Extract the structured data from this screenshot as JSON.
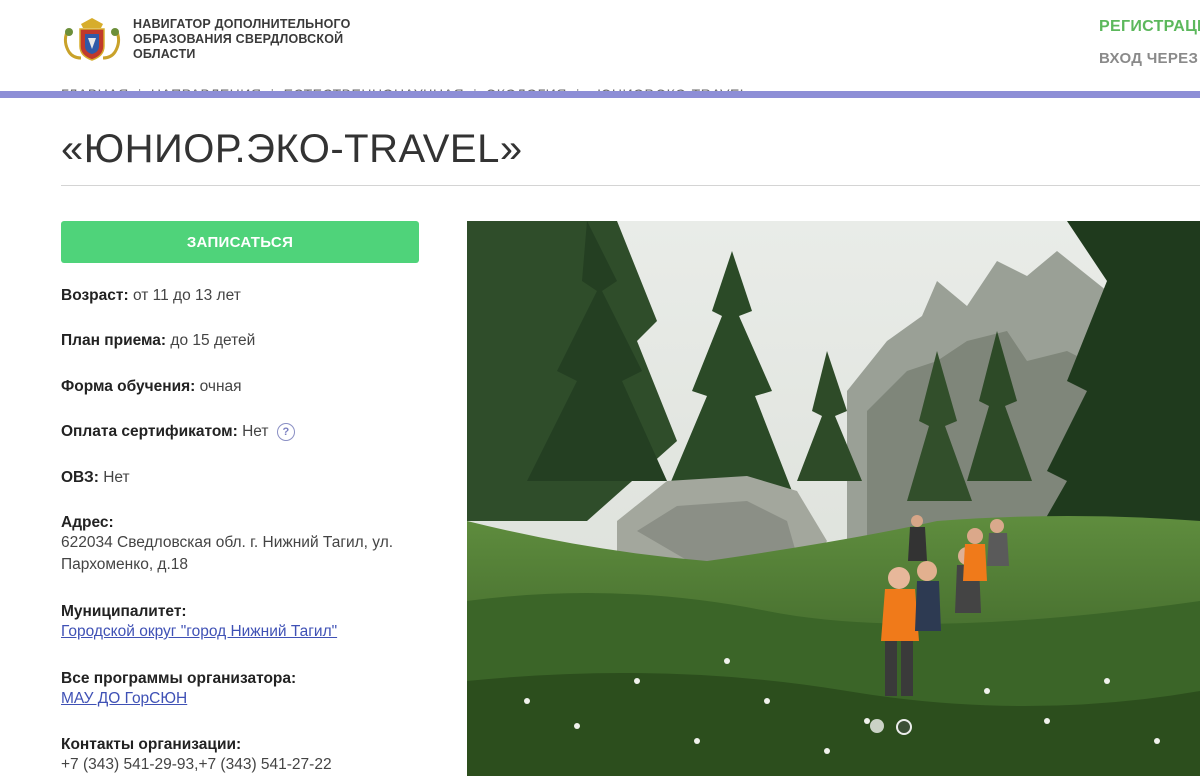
{
  "header": {
    "site_name": "НАВИГАТОР ДОПОЛНИТЕЛЬНОГО ОБРАЗОВАНИЯ СВЕРДЛОВСКОЙ ОБЛАСТИ",
    "register_label": "РЕГИСТРАЦИЯ",
    "login_label": "ВХОД ЧЕРЕЗ",
    "logo_icon": "coat-of-arms-icon",
    "accent_bar_color": "#8d8ed6"
  },
  "breadcrumb": [
    "ГЛАВНАЯ",
    "НАПРАВЛЕНИЯ",
    "ЕСТЕСТВЕННОНАУЧНАЯ",
    "ЭКОЛОГИЯ",
    "«ЮНИОР.ЭКО-TRAVEL»"
  ],
  "page": {
    "title": "«ЮНИОР.ЭКО-TRAVEL»"
  },
  "enroll_button": {
    "label": "ЗАПИСАТЬСЯ",
    "color": "#4fd37a"
  },
  "info": {
    "age_label": "Возраст:",
    "age_value": "от 11 до 13 лет",
    "plan_label": "План приема:",
    "plan_value": "до 15 детей",
    "form_label": "Форма обучения:",
    "form_value": "очная",
    "payment_label": "Оплата сертификатом:",
    "payment_value": "Нет",
    "payment_help": "?",
    "ovz_label": "ОВЗ:",
    "ovz_value": "Нет",
    "address_label": "Адрес:",
    "address_value": "622034 Сведловская обл. г. Нижний Тагил, ул. Пархоменко, д.18",
    "municipality_label": "Муниципалитет:",
    "municipality_value": "Городской округ \"город Нижний Тагил\"",
    "programs_label": "Все программы организатора:",
    "programs_value": "МАУ ДО ГорСЮН",
    "contacts_label": "Контакты организации:",
    "contacts_value": "+7 (343) 541-29-93,+7 (343) 541-27-22"
  },
  "gallery": {
    "image_alt": "Группа детей в походе по лесу у скал",
    "slide_count": 2,
    "active_slide": 2
  }
}
